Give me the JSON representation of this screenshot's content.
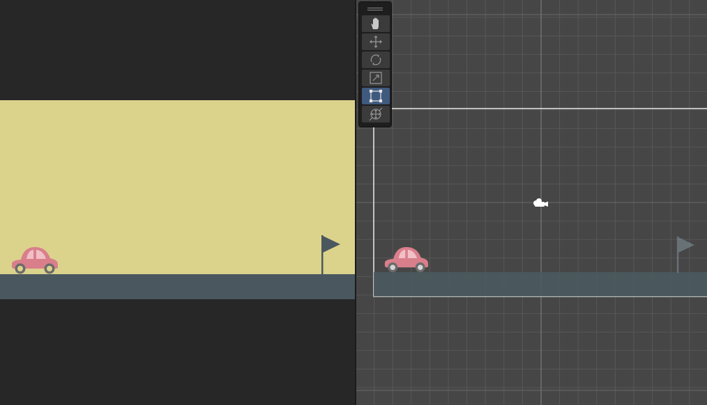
{
  "app": {
    "layout": [
      "game-view",
      "scene-view"
    ]
  },
  "game_view": {
    "sky_color": "#dbd38c",
    "ground_color": "#4b575e",
    "car_color": "#d97f8b",
    "flag_color": "#4b575e"
  },
  "scene_view": {
    "background_color": "#464646",
    "grid_color": "#575757",
    "frame_color": "#e8e8e8",
    "camera_icon": "camera-icon"
  },
  "toolbar": {
    "tools": [
      {
        "name": "hand-tool",
        "icon": "hand-icon",
        "active": false
      },
      {
        "name": "move-tool",
        "icon": "move-arrows-icon",
        "active": false
      },
      {
        "name": "rotate-tool",
        "icon": "rotate-icon",
        "active": false
      },
      {
        "name": "scale-tool",
        "icon": "scale-icon",
        "active": false
      },
      {
        "name": "rect-tool",
        "icon": "rect-transform-icon",
        "active": true
      },
      {
        "name": "transform-tool",
        "icon": "transform-icon",
        "active": false
      }
    ],
    "active_color": "#3f5a7d"
  }
}
